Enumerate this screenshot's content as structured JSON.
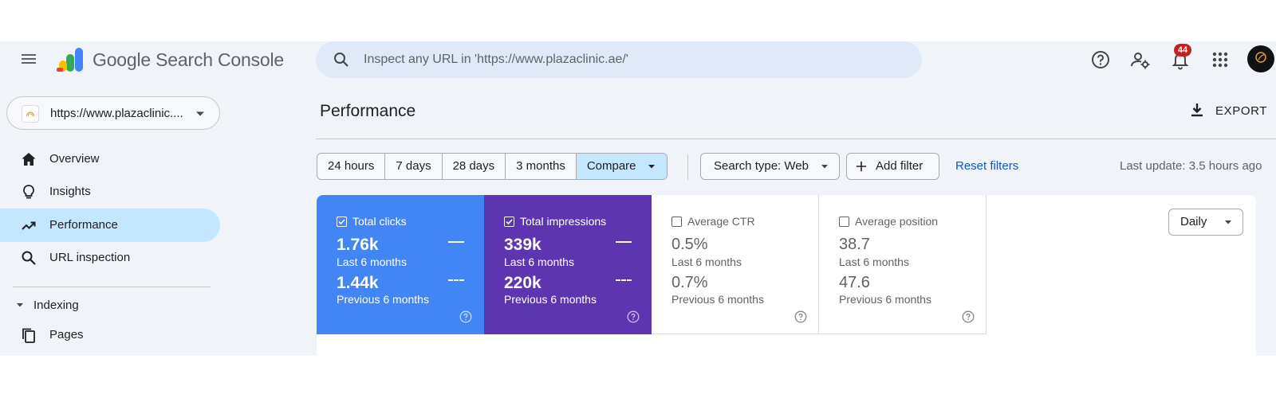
{
  "header": {
    "brand": "Google Search Console",
    "search_placeholder": "Inspect any URL in 'https://www.plazaclinic.ae/'",
    "notification_count": "44",
    "icons": [
      "menu-icon",
      "search-icon",
      "help-icon",
      "manage-users-icon",
      "notifications-icon",
      "apps-grid-icon",
      "avatar"
    ]
  },
  "sidebar": {
    "property": "https://www.plazaclinic....",
    "items": [
      {
        "label": "Overview",
        "icon": "home-icon",
        "active": false
      },
      {
        "label": "Insights",
        "icon": "lightbulb-icon",
        "active": false
      },
      {
        "label": "Performance",
        "icon": "trending-up-icon",
        "active": true
      },
      {
        "label": "URL inspection",
        "icon": "search-icon",
        "active": false
      }
    ],
    "section": "Indexing",
    "section_items": [
      {
        "label": "Pages",
        "icon": "pages-icon"
      }
    ]
  },
  "main": {
    "title": "Performance",
    "export_label": "EXPORT",
    "date_ranges": [
      "24 hours",
      "7 days",
      "28 days",
      "3 months",
      "Compare"
    ],
    "selected_range": "Compare",
    "search_type": "Search type: Web",
    "add_filter": "Add filter",
    "reset_filters": "Reset filters",
    "last_update": "Last update: 3.5 hours ago",
    "granularity": "Daily"
  },
  "metrics": [
    {
      "title": "Total clicks",
      "checked": true,
      "current": "1.76k",
      "current_label": "Last 6 months",
      "previous": "1.44k",
      "previous_label": "Previous 6 months",
      "color": "#4285f4"
    },
    {
      "title": "Total impressions",
      "checked": true,
      "current": "339k",
      "current_label": "Last 6 months",
      "previous": "220k",
      "previous_label": "Previous 6 months",
      "color": "#5e35b1"
    },
    {
      "title": "Average CTR",
      "checked": false,
      "current": "0.5%",
      "current_label": "Last 6 months",
      "previous": "0.7%",
      "previous_label": "Previous 6 months",
      "color": "#ffffff"
    },
    {
      "title": "Average position",
      "checked": false,
      "current": "38.7",
      "current_label": "Last 6 months",
      "previous": "47.6",
      "previous_label": "Previous 6 months",
      "color": "#ffffff"
    }
  ],
  "colors": {
    "app_background": "#f0f4f9",
    "active_nav": "#c2e7ff",
    "clicks_blue": "#4285f4",
    "impressions_purple": "#5e35b1",
    "link_blue": "#0b57d0",
    "badge_red": "#c5221f"
  }
}
